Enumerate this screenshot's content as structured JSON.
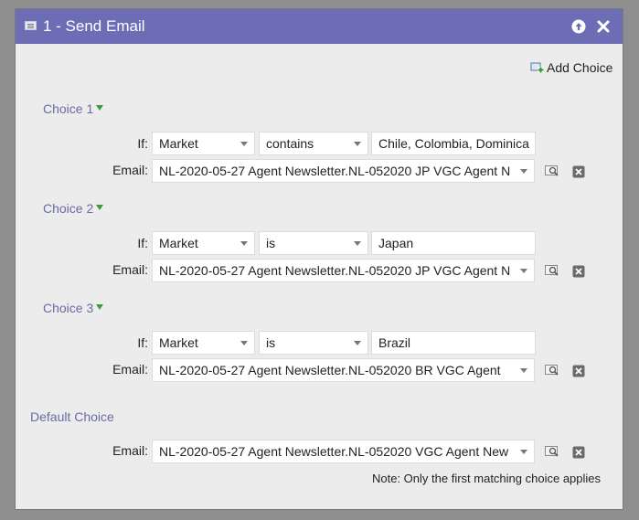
{
  "dialog": {
    "title": "1 - Send Email",
    "add_choice_label": "Add Choice",
    "note": "Note: Only the first matching choice applies"
  },
  "labels": {
    "if": "If:",
    "email": "Email:"
  },
  "choices": [
    {
      "label": "Choice 1",
      "field": "Market",
      "operator": "contains",
      "value": "Chile, Colombia, Dominica",
      "email": "NL-2020-05-27 Agent Newsletter.NL-052020 JP VGC Agent N"
    },
    {
      "label": "Choice 2",
      "field": "Market",
      "operator": "is",
      "value": "Japan",
      "email": "NL-2020-05-27 Agent Newsletter.NL-052020 JP VGC Agent N"
    },
    {
      "label": "Choice 3",
      "field": "Market",
      "operator": "is",
      "value": "Brazil",
      "email": "NL-2020-05-27 Agent Newsletter.NL-052020 BR VGC Agent"
    }
  ],
  "default_choice": {
    "label": "Default Choice",
    "email": "NL-2020-05-27 Agent Newsletter.NL-052020 VGC Agent New"
  },
  "icons": {
    "title": "email-step-icon",
    "collapse": "arrow-up-icon",
    "close": "close-icon",
    "add": "add-choice-icon",
    "preview": "preview-icon",
    "delete": "delete-icon",
    "choice_toggle": "triangle-down-icon"
  },
  "colors": {
    "titlebar": "#6d6db5",
    "choice_label": "#6a6aa8",
    "dialog_bg": "#ececec"
  }
}
